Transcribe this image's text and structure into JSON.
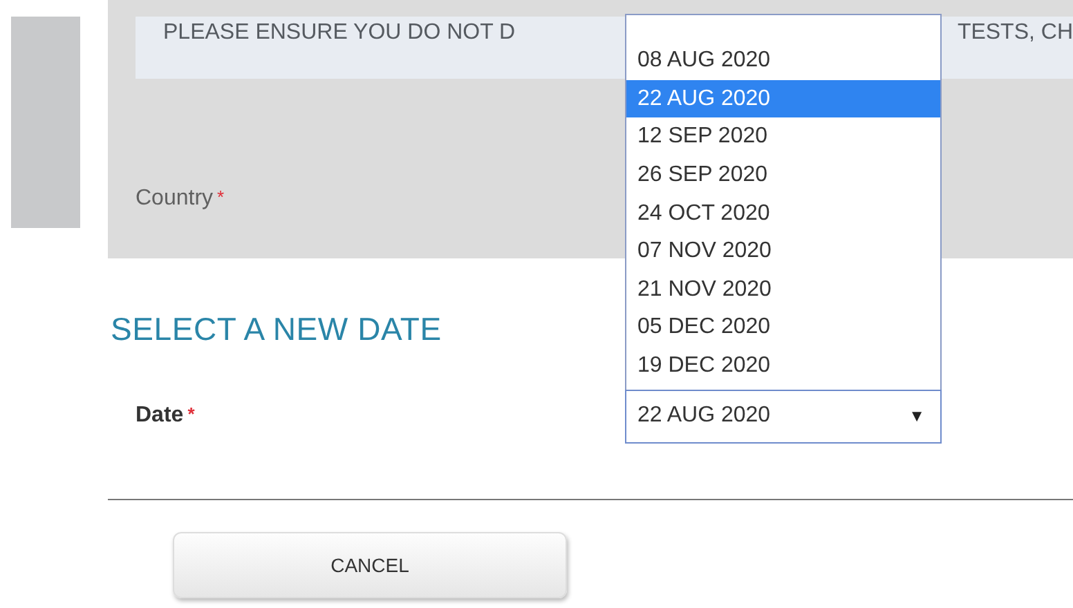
{
  "notice": {
    "text_parts": [
      "PLEASE ENSURE YOU DO NOT D",
      "TESTS, CH"
    ]
  },
  "country_field": {
    "label": "Country",
    "required_mark": "*"
  },
  "section_title": "SELECT A NEW DATE",
  "date_field": {
    "label": "Date",
    "required_mark": "*",
    "value": "22 AUG 2020",
    "arrow": "▼",
    "expanded": true,
    "options": [
      {
        "label": "08 AUG 2020",
        "selected": false
      },
      {
        "label": "22 AUG 2020",
        "selected": true
      },
      {
        "label": "12 SEP 2020",
        "selected": false
      },
      {
        "label": "26 SEP 2020",
        "selected": false
      },
      {
        "label": "24 OCT 2020",
        "selected": false
      },
      {
        "label": "07 NOV 2020",
        "selected": false
      },
      {
        "label": "21 NOV 2020",
        "selected": false
      },
      {
        "label": "05 DEC 2020",
        "selected": false
      },
      {
        "label": "19 DEC 2020",
        "selected": false
      }
    ]
  },
  "buttons": [
    {
      "label": "CANCEL"
    }
  ]
}
